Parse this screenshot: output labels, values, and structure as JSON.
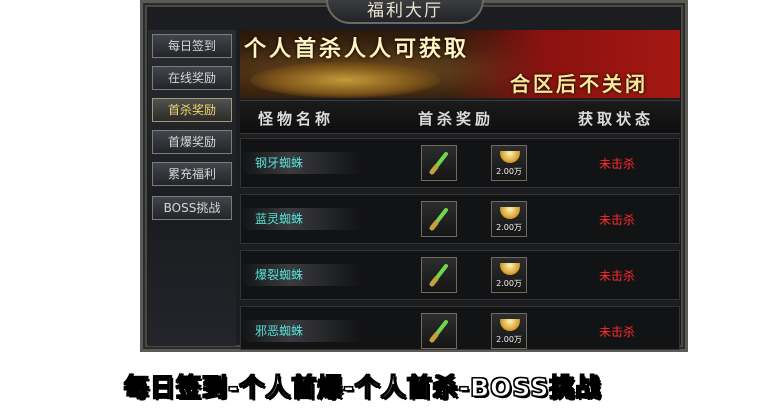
{
  "window": {
    "title": "福利大厅"
  },
  "sidebar": {
    "items": [
      {
        "label": "每日签到",
        "active": false
      },
      {
        "label": "在线奖励",
        "active": false
      },
      {
        "label": "首杀奖励",
        "active": true
      },
      {
        "label": "首爆奖励",
        "active": false
      },
      {
        "label": "累充福利",
        "active": false
      },
      {
        "label": "BOSS挑战",
        "active": false
      }
    ]
  },
  "banner": {
    "title": "个人首杀人人可获取",
    "subtitle": "合区后不关闭"
  },
  "table": {
    "headers": [
      "怪物名称",
      "首杀奖励",
      "获取状态"
    ],
    "rows": [
      {
        "monster": "钢牙蜘蛛",
        "reward_item_icon": "sword-item-icon",
        "gold_amount": "2.00万",
        "status": "未击杀"
      },
      {
        "monster": "蓝灵蜘蛛",
        "reward_item_icon": "sword-item-icon",
        "gold_amount": "2.00万",
        "status": "未击杀"
      },
      {
        "monster": "爆裂蜘蛛",
        "reward_item_icon": "sword-item-icon",
        "gold_amount": "2.00万",
        "status": "未击杀"
      },
      {
        "monster": "邪恶蜘蛛",
        "reward_item_icon": "sword-item-icon",
        "gold_amount": "2.00万",
        "status": "未击杀"
      }
    ]
  },
  "footer": {
    "caption": "每日签到-个人首爆-个人首杀-BOSS挑战"
  },
  "colors": {
    "monster_name": "#58e0d7",
    "status_red": "#ff2a2a",
    "active_tab": "#f3d46a"
  }
}
